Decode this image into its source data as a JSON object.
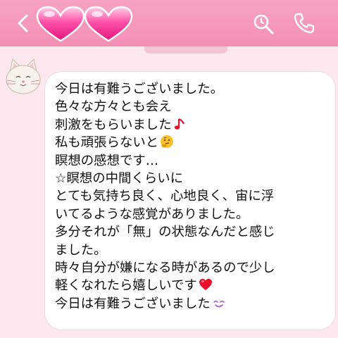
{
  "header": {
    "back_icon": "chevron-left-icon",
    "title_icon": "double-pink-heart-icon",
    "search_icon": "search-icon",
    "call_icon": "phone-icon",
    "bg_color": "#f490b5"
  },
  "sender": {
    "avatar_icon": "white-cat-avatar-icon"
  },
  "message": {
    "lines": [
      {
        "text": "今日は有難うございました。",
        "emoji": null
      },
      {
        "text": "色々な方々とも会え",
        "emoji": null
      },
      {
        "text": "刺激をもらいました",
        "emoji": "red-music-note-icon"
      },
      {
        "text": "私も頑張らないと",
        "emoji": "thinking-face-icon"
      },
      {
        "text": "瞑想の感想です…",
        "emoji": null
      },
      {
        "text": " ☆瞑想の中間くらいに",
        "emoji": null
      },
      {
        "text": "とても気持ち良く、心地良く、宙に浮",
        "emoji": null
      },
      {
        "text": "いてるような感覚がありました。",
        "emoji": null
      },
      {
        "text": "多分それが「無」の状態なんだと感じ",
        "emoji": null
      },
      {
        "text": "ました。",
        "emoji": null
      },
      {
        "text": "時々自分が嫌になる時があるので少し",
        "emoji": null
      },
      {
        "text": "軽くなれたら嬉しいです",
        "emoji": "red-heart-icon"
      },
      {
        "text": "今日は有難うございました",
        "emoji": "smiling-eyes-icon"
      }
    ]
  }
}
